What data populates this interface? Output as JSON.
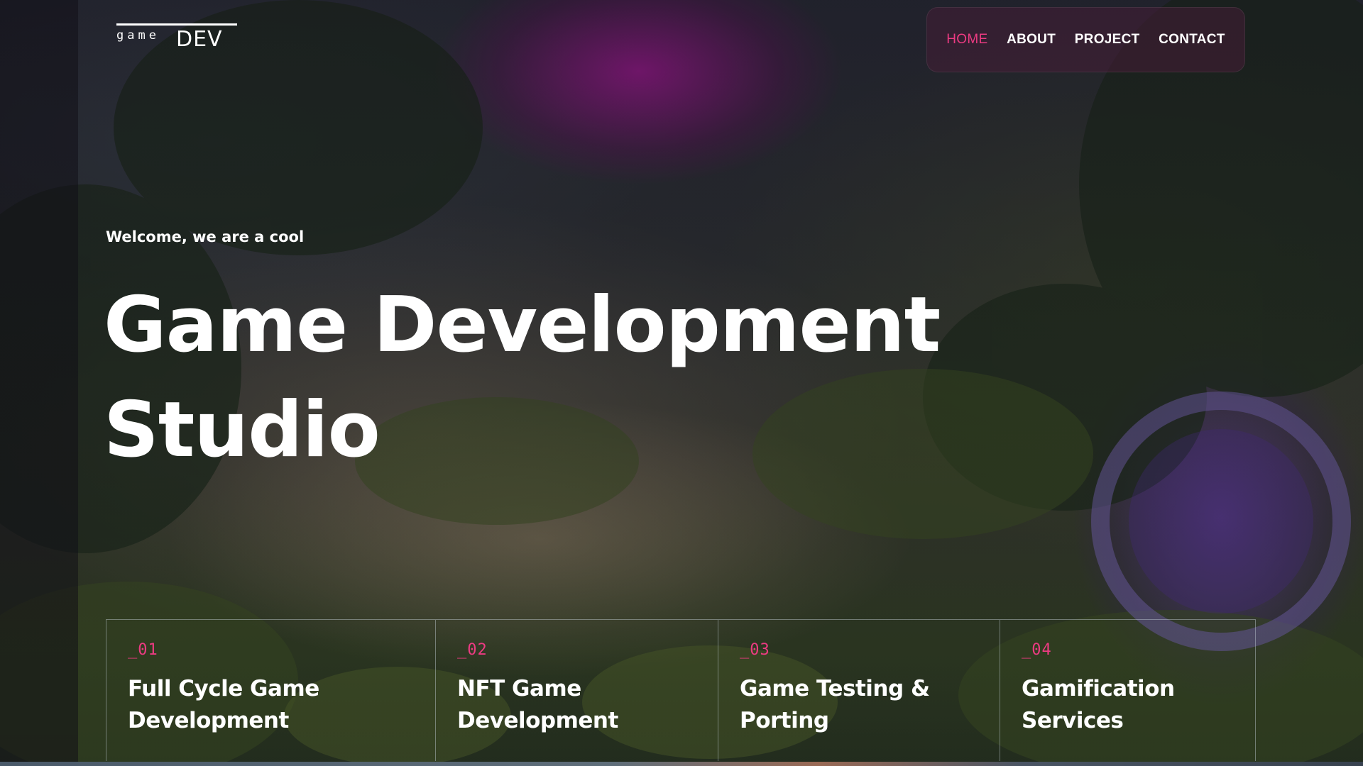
{
  "header": {
    "logo": {
      "small": "game",
      "large": "DEV"
    },
    "nav": [
      {
        "label": "HOME",
        "active": true
      },
      {
        "label": "ABOUT",
        "active": false
      },
      {
        "label": "PROJECT",
        "active": false
      },
      {
        "label": "CONTACT",
        "active": false
      }
    ]
  },
  "hero": {
    "welcome": "Welcome, we are a cool",
    "title_line1": "Game Development",
    "title_line2": "Studio"
  },
  "services": [
    {
      "number": "_01",
      "title_line1": "Full Cycle Game",
      "title_line2": "Development"
    },
    {
      "number": "_02",
      "title_line1": "NFT Game",
      "title_line2": "Development"
    },
    {
      "number": "_03",
      "title_line1": "Game Testing &",
      "title_line2": "Porting"
    },
    {
      "number": "_04",
      "title_line1": "Gamification",
      "title_line2": "Services"
    }
  ],
  "colors": {
    "accent": "#ec3b82",
    "nav_background": "#461e37"
  }
}
